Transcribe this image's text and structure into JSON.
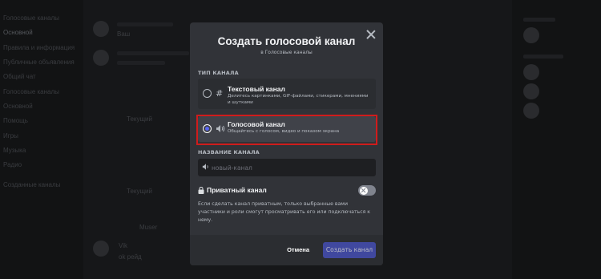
{
  "background": {
    "sidebar_items": [
      "Голосовые каналы",
      "Основной",
      "Правила и информация",
      "Публичные объявления",
      "Общий чат",
      "Голосовые каналы",
      "Основной",
      "Помощь",
      "Игры",
      "Музыка",
      "Радио",
      "Созданные каналы"
    ],
    "chat_snippets": [
      "Ваш",
      "Текущий",
      "Текущий",
      "Muser",
      "Vik",
      "ok рейд"
    ]
  },
  "modal": {
    "title": "Создать голосовой канал",
    "subtitle": "в Голосовые каналы",
    "channel_type_label": "ТИП КАНАЛА",
    "options": [
      {
        "icon": "hash-icon",
        "glyph": "#",
        "title": "Текстовый канал",
        "description": "Делитесь картинками, GIF-файлами, стикерами, мнениями и шутками",
        "selected": false
      },
      {
        "icon": "speaker-icon",
        "glyph": "🔊",
        "title": "Голосовой канал",
        "description": "Общайтесь с голосом, видео и показом экрана",
        "selected": true
      }
    ],
    "channel_name_label": "НАЗВАНИЕ КАНАЛА",
    "channel_name_placeholder": "новый-канал",
    "channel_name_value": "",
    "private_label": "Приватный канал",
    "private_enabled": false,
    "private_description": "Если сделать канал приватным, только выбранные вами участники и роли смогут просматривать его или подключаться к нему.",
    "cancel_label": "Отмена",
    "create_label": "Создать канал"
  },
  "colors": {
    "accent": "#5865f2",
    "highlight": "#d01c1c",
    "modal_bg": "#313338",
    "footer_bg": "#2b2d31"
  }
}
